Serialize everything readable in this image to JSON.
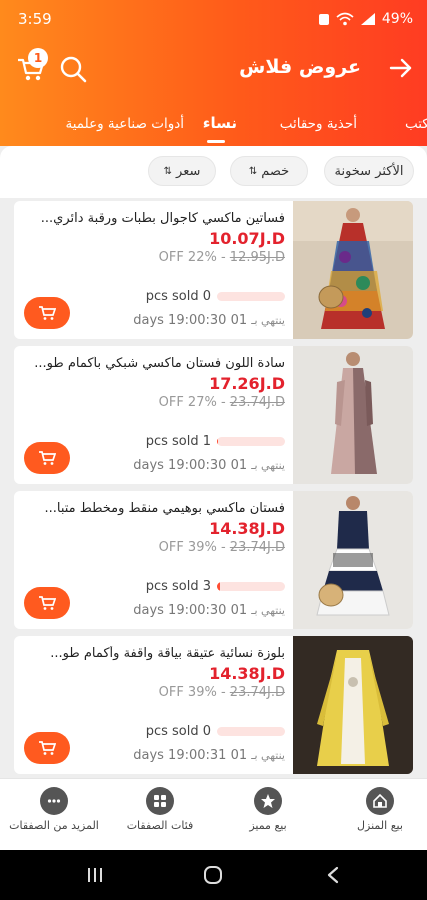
{
  "status": {
    "time": "3:59",
    "battery": "49%"
  },
  "header": {
    "title": "عروض فلاش",
    "cart_count": "1"
  },
  "tabs": [
    {
      "label": "مكتب"
    },
    {
      "label": "أحذية وحقائب"
    },
    {
      "label": "نساء",
      "active": true
    },
    {
      "label": "أدوات صناعية وعلمية"
    }
  ],
  "sort": [
    {
      "label": "الأكثر سخونة"
    },
    {
      "label": "خصم"
    },
    {
      "label": "سعر"
    }
  ],
  "products": [
    {
      "title": "فساتين ماكسي كاجوال بطبات ورقبة دائري...",
      "price": "10.07J.D",
      "old_price": "12.95J.D",
      "discount": "OFF 22%",
      "sold": "pcs sold 0",
      "sold_ratio": 0,
      "ends_label": "ينتهي بـ",
      "timer": "days 19:00:30 01"
    },
    {
      "title": "سادة اللون فستان ماكسي شبكي بأكمام طو...",
      "price": "17.26J.D",
      "old_price": "23.74J.D",
      "discount": "OFF 27%",
      "sold": "pcs sold 1",
      "sold_ratio": 0.02,
      "ends_label": "ينتهي بـ",
      "timer": "days 19:00:30 01"
    },
    {
      "title": "فستان ماكسي بوهيمي منقط ومخطط متبا...",
      "price": "14.38J.D",
      "old_price": "23.74J.D",
      "discount": "OFF 39%",
      "sold": "pcs sold 3",
      "sold_ratio": 0.04,
      "ends_label": "ينتهي بـ",
      "timer": "days 19:00:30 01"
    },
    {
      "title": "بلوزة نسائية عتيقة بياقة واقفة وأكمام طو...",
      "price": "14.38J.D",
      "old_price": "23.74J.D",
      "discount": "OFF 39%",
      "sold": "pcs sold 0",
      "sold_ratio": 0,
      "ends_label": "ينتهي بـ",
      "timer": "days 19:00:31 01"
    }
  ],
  "bottom_nav": [
    {
      "label": "بيع المنزل",
      "icon": "home-icon"
    },
    {
      "label": "بيع مميز",
      "icon": "star-icon"
    },
    {
      "label": "فئات الصفقات",
      "icon": "grid-icon"
    },
    {
      "label": "المزيد من الصفقات",
      "icon": "more-icon"
    }
  ],
  "colors": {
    "accent": "#ff5a1f",
    "price": "#e3222d",
    "header_start": "#ff8a1c",
    "header_end": "#ff3c22"
  }
}
